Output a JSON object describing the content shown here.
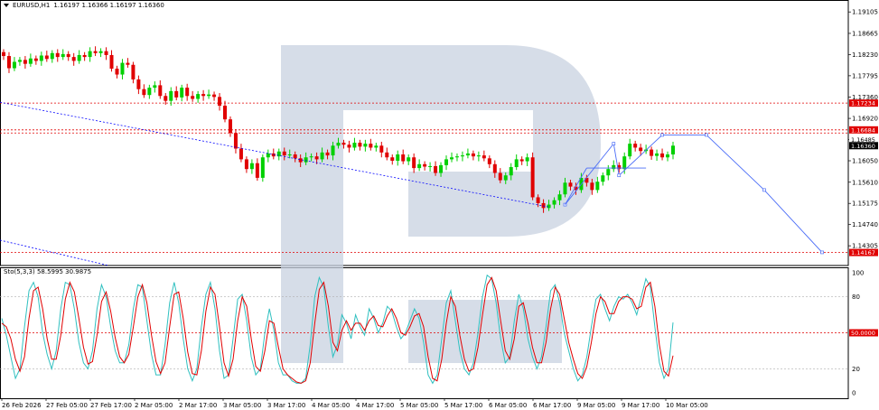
{
  "header": {
    "symbol": "EURUSD,H1",
    "ohlc": "1.16197 1.16366 1.16197 1.16360"
  },
  "oscillator": {
    "label": "Sto(5,3,3) 58.5995 30.9875"
  },
  "colors": {
    "bull": "#00d000",
    "bear": "#e00000",
    "level": "#e00000",
    "trend": "#0000ff",
    "forecast": "#4a6cf7",
    "sto_main": "#30c0c0",
    "sto_signal": "#e00000",
    "watermark": "#c8d2e0"
  },
  "chart_data": [
    {
      "type": "candlestick",
      "title": "EURUSD,H1",
      "ylim": [
        1.139,
        1.1935
      ],
      "y_ticks": [
        "1.19105",
        "1.18665",
        "1.18230",
        "1.17795",
        "1.17360",
        "1.16920",
        "1.16485",
        "1.16050",
        "1.15610",
        "1.15175",
        "1.14740",
        "1.14305"
      ],
      "x_ticks": [
        "26 Feb 2026",
        "27 Feb 05:00",
        "27 Feb 17:00",
        "2 Mar 05:00",
        "2 Mar 17:00",
        "3 Mar 05:00",
        "3 Mar 17:00",
        "4 Mar 05:00",
        "4 Mar 17:00",
        "5 Mar 05:00",
        "5 Mar 17:00",
        "6 Mar 05:00",
        "6 Mar 17:00",
        "9 Mar 05:00",
        "9 Mar 17:00",
        "10 Mar 05:00"
      ],
      "price_labels": [
        {
          "value": 1.17234,
          "text": "1.17234",
          "style": "red"
        },
        {
          "value": 1.16684,
          "text": "1.16684",
          "style": "red"
        },
        {
          "value": 1.16485,
          "text": "1.16485",
          "style": "plain"
        },
        {
          "value": 1.1636,
          "text": "1.16360",
          "style": "dark"
        },
        {
          "value": 1.14167,
          "text": "1.14167",
          "style": "red"
        }
      ],
      "levels": [
        1.17234,
        1.16684,
        1.1662,
        1.14167
      ],
      "closes": [
        1.182,
        1.1795,
        1.1808,
        1.1812,
        1.1804,
        1.1815,
        1.181,
        1.1821,
        1.1814,
        1.1826,
        1.1818,
        1.1824,
        1.1818,
        1.181,
        1.1822,
        1.1818,
        1.183,
        1.1826,
        1.183,
        1.1822,
        1.1794,
        1.1782,
        1.1806,
        1.1802,
        1.1772,
        1.1752,
        1.174,
        1.1755,
        1.176,
        1.1738,
        1.1728,
        1.1748,
        1.1735,
        1.1755,
        1.1738,
        1.1732,
        1.1742,
        1.1738,
        1.1741,
        1.1736,
        1.1718,
        1.169,
        1.1662,
        1.163,
        1.1608,
        1.1588,
        1.16,
        1.157,
        1.1612,
        1.162,
        1.1614,
        1.1624,
        1.1616,
        1.1618,
        1.161,
        1.1602,
        1.1612,
        1.1614,
        1.1608,
        1.1622,
        1.1616,
        1.1636,
        1.1642,
        1.1638,
        1.1632,
        1.1642,
        1.1634,
        1.164,
        1.1632,
        1.1636,
        1.1622,
        1.1612,
        1.1605,
        1.1618,
        1.1604,
        1.1612,
        1.159,
        1.1598,
        1.1593,
        1.1594,
        1.158,
        1.1596,
        1.1608,
        1.1612,
        1.1614,
        1.1616,
        1.162,
        1.1614,
        1.1616,
        1.161,
        1.1598,
        1.158,
        1.1565,
        1.1575,
        1.1592,
        1.1608,
        1.1604,
        1.1612,
        1.153,
        1.1518,
        1.1508,
        1.1515,
        1.1524,
        1.1536,
        1.156,
        1.1552,
        1.1545,
        1.157,
        1.156,
        1.1545,
        1.1562,
        1.1575,
        1.1588,
        1.1596,
        1.1588,
        1.1614,
        1.164,
        1.1632,
        1.1625,
        1.1628,
        1.1615,
        1.162,
        1.1612,
        1.1618,
        1.1636
      ]
    },
    {
      "type": "line",
      "title": "Sto(5,3,3) 58.5995 30.9875",
      "ylim": [
        0,
        100
      ],
      "y_ticks": [
        "100",
        "80",
        "20",
        "0"
      ],
      "level_label": "50.0000",
      "series": [
        {
          "name": "58.5995",
          "values": [
            62,
            48,
            30,
            12,
            20,
            55,
            85,
            92,
            80,
            50,
            32,
            20,
            35,
            70,
            92,
            90,
            70,
            42,
            25,
            20,
            35,
            70,
            90,
            80,
            55,
            35,
            25,
            25,
            40,
            70,
            90,
            88,
            60,
            32,
            15,
            15,
            40,
            75,
            92,
            75,
            45,
            20,
            10,
            20,
            55,
            82,
            92,
            70,
            35,
            12,
            15,
            45,
            78,
            82,
            60,
            30,
            15,
            20,
            50,
            70,
            52,
            25,
            15,
            15,
            10,
            8,
            8,
            12,
            40,
            80,
            96,
            88,
            55,
            30,
            40,
            65,
            58,
            45,
            65,
            55,
            48,
            70,
            62,
            50,
            58,
            72,
            68,
            55,
            45,
            50,
            60,
            70,
            62,
            42,
            15,
            8,
            15,
            45,
            75,
            85,
            60,
            35,
            20,
            15,
            25,
            50,
            80,
            98,
            95,
            75,
            45,
            25,
            30,
            60,
            82,
            70,
            45,
            30,
            20,
            30,
            55,
            85,
            90,
            75,
            50,
            35,
            20,
            10,
            15,
            30,
            55,
            78,
            82,
            70,
            60,
            72,
            80,
            78,
            82,
            75,
            65,
            80,
            95,
            88,
            55,
            25,
            12,
            20,
            58.6
          ]
        },
        {
          "name": "30.9875",
          "values": [
            58,
            55,
            45,
            28,
            18,
            30,
            62,
            85,
            88,
            70,
            45,
            28,
            28,
            48,
            78,
            92,
            84,
            62,
            38,
            24,
            26,
            48,
            76,
            84,
            68,
            46,
            30,
            25,
            32,
            55,
            80,
            90,
            75,
            48,
            26,
            16,
            25,
            55,
            82,
            84,
            62,
            34,
            16,
            15,
            35,
            68,
            88,
            82,
            55,
            25,
            14,
            28,
            60,
            80,
            72,
            45,
            22,
            18,
            35,
            60,
            58,
            38,
            20,
            15,
            12,
            9,
            8,
            10,
            25,
            58,
            86,
            92,
            72,
            42,
            35,
            52,
            60,
            52,
            58,
            58,
            52,
            60,
            64,
            56,
            55,
            64,
            70,
            62,
            50,
            48,
            55,
            64,
            66,
            55,
            30,
            12,
            10,
            28,
            58,
            80,
            72,
            48,
            28,
            18,
            20,
            38,
            65,
            90,
            96,
            85,
            60,
            35,
            28,
            45,
            72,
            75,
            58,
            38,
            25,
            25,
            42,
            70,
            88,
            82,
            62,
            42,
            28,
            16,
            12,
            22,
            42,
            66,
            80,
            76,
            66,
            66,
            76,
            80,
            80,
            78,
            70,
            72,
            88,
            92,
            72,
            40,
            18,
            14,
            31.0
          ]
        }
      ]
    }
  ]
}
